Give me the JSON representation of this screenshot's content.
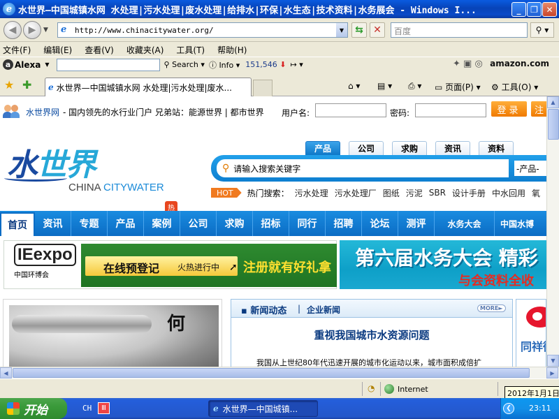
{
  "window": {
    "title": "水世界—中国城镇水网 水处理|污水处理|废水处理|给排水|环保|水生态|技术资料|水务展会 - Windows I...",
    "minimize": "_",
    "maximize": "❐",
    "close": "✕"
  },
  "address_bar": {
    "url": "http://www.chinacitywater.org/",
    "search_placeholder": "百度"
  },
  "menu": [
    "文件(F)",
    "编辑(E)",
    "查看(V)",
    "收藏夹(A)",
    "工具(T)",
    "帮助(H)"
  ],
  "alexa_toolbar": {
    "logo": "Alexa",
    "search": "Search",
    "info": "Info",
    "rank": "151,546",
    "amazon": "amazon.com"
  },
  "tabs": {
    "active_title": "水世界—中国城镇水网 水处理|污水处理|废水...",
    "home_label": "",
    "page_label": "页面(P)",
    "tools_label": "工具(O)"
  },
  "site": {
    "brand": "水世界网",
    "slogan": "- 国内领先的水行业门户 兄弟站：能源世界 | 都市世界",
    "username_label": "用户名:",
    "password_label": "密码:",
    "login_button": "登录",
    "register_button": "注",
    "logo_calligraphy_1": "水",
    "logo_calligraphy_2": "世界",
    "logo_en_1": "CHINA ",
    "logo_en_2": "CITYWATER",
    "search_tabs": [
      "产品",
      "公司",
      "求购",
      "资讯",
      "资料"
    ],
    "search_placeholder": "请输入搜索关键字",
    "search_select": "-产品-",
    "hot_badge": "HOT",
    "hot_label": "热门搜索：",
    "hot_keywords": [
      "污水处理",
      "污水处理厂",
      "图纸",
      "污泥",
      "SBR",
      "设计手册",
      "中水回用",
      "氧"
    ],
    "nav": [
      "首页",
      "资讯",
      "专题",
      "产品",
      "案例",
      "公司",
      "求购",
      "招标",
      "同行",
      "招聘",
      "论坛",
      "测评",
      "水务大会",
      "中国水博"
    ],
    "nav_hot_mark": "热",
    "banner_left": {
      "logo": "IEexpo",
      "logo_sub": "中国环博会",
      "pre_register": "在线预登记",
      "hot_progress": "火热进行中",
      "gift": "注册就有好礼拿"
    },
    "banner_right": {
      "title": "第六届水务大会 精彩",
      "subtitle": "与会资料全收"
    },
    "photo_calligraphy": "何",
    "news": {
      "tab_active": "新闻动态",
      "tab_other": "企业新闻",
      "more": "MORE►",
      "headline": "重视我国城市水资源问题",
      "excerpt": "我国从上世纪80年代迅速开展的城市化运动以来，城市面积成倍扩"
    },
    "weibo_text": "同祥微"
  },
  "status_bar": {
    "zone": "Internet",
    "tooltip": "2012年1月1日"
  },
  "taskbar": {
    "start": "开始",
    "ime": "CH",
    "ime_badge": "Ⅲ",
    "task_item": "水世界—中国城镇...",
    "time": "23:11"
  }
}
